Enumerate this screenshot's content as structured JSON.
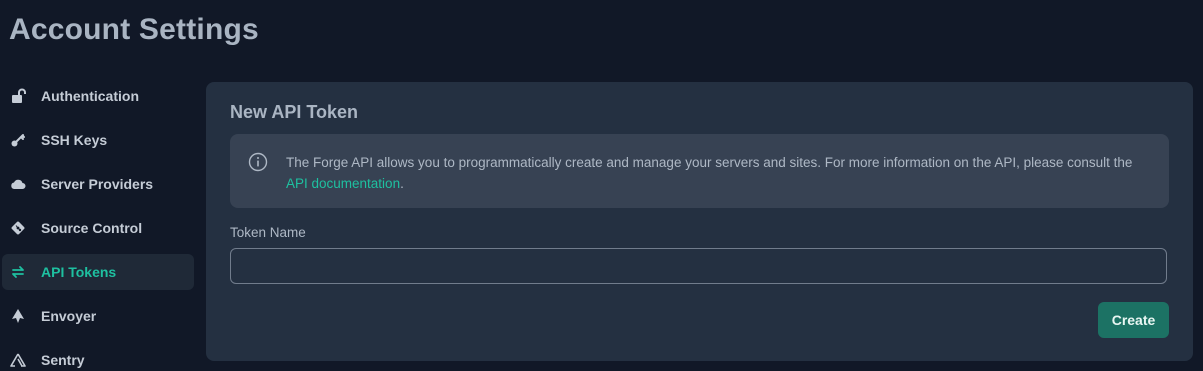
{
  "page": {
    "title": "Account Settings"
  },
  "sidebar": {
    "items": [
      {
        "label": "Authentication",
        "icon": "unlock-icon",
        "active": false
      },
      {
        "label": "SSH Keys",
        "icon": "key-icon",
        "active": false
      },
      {
        "label": "Server Providers",
        "icon": "cloud-icon",
        "active": false
      },
      {
        "label": "Source Control",
        "icon": "git-icon",
        "active": false
      },
      {
        "label": "API Tokens",
        "icon": "arrows-exchange-icon",
        "active": true
      },
      {
        "label": "Envoyer",
        "icon": "envoyer-icon",
        "active": false
      },
      {
        "label": "Sentry",
        "icon": "sentry-icon",
        "active": false
      }
    ]
  },
  "panel": {
    "title": "New API Token",
    "info": {
      "icon": "info-circle-icon",
      "text_before": "The Forge API allows you to programmatically create and manage your servers and sites. For more information on the API, please consult the ",
      "link_text": "API documentation",
      "text_after": "."
    },
    "token_name": {
      "label": "Token Name",
      "value": "",
      "placeholder": ""
    },
    "create_label": "Create"
  },
  "colors": {
    "background": "#111827",
    "panel": "#243041",
    "accent": "#1ec0a0",
    "button": "#1c7264"
  }
}
